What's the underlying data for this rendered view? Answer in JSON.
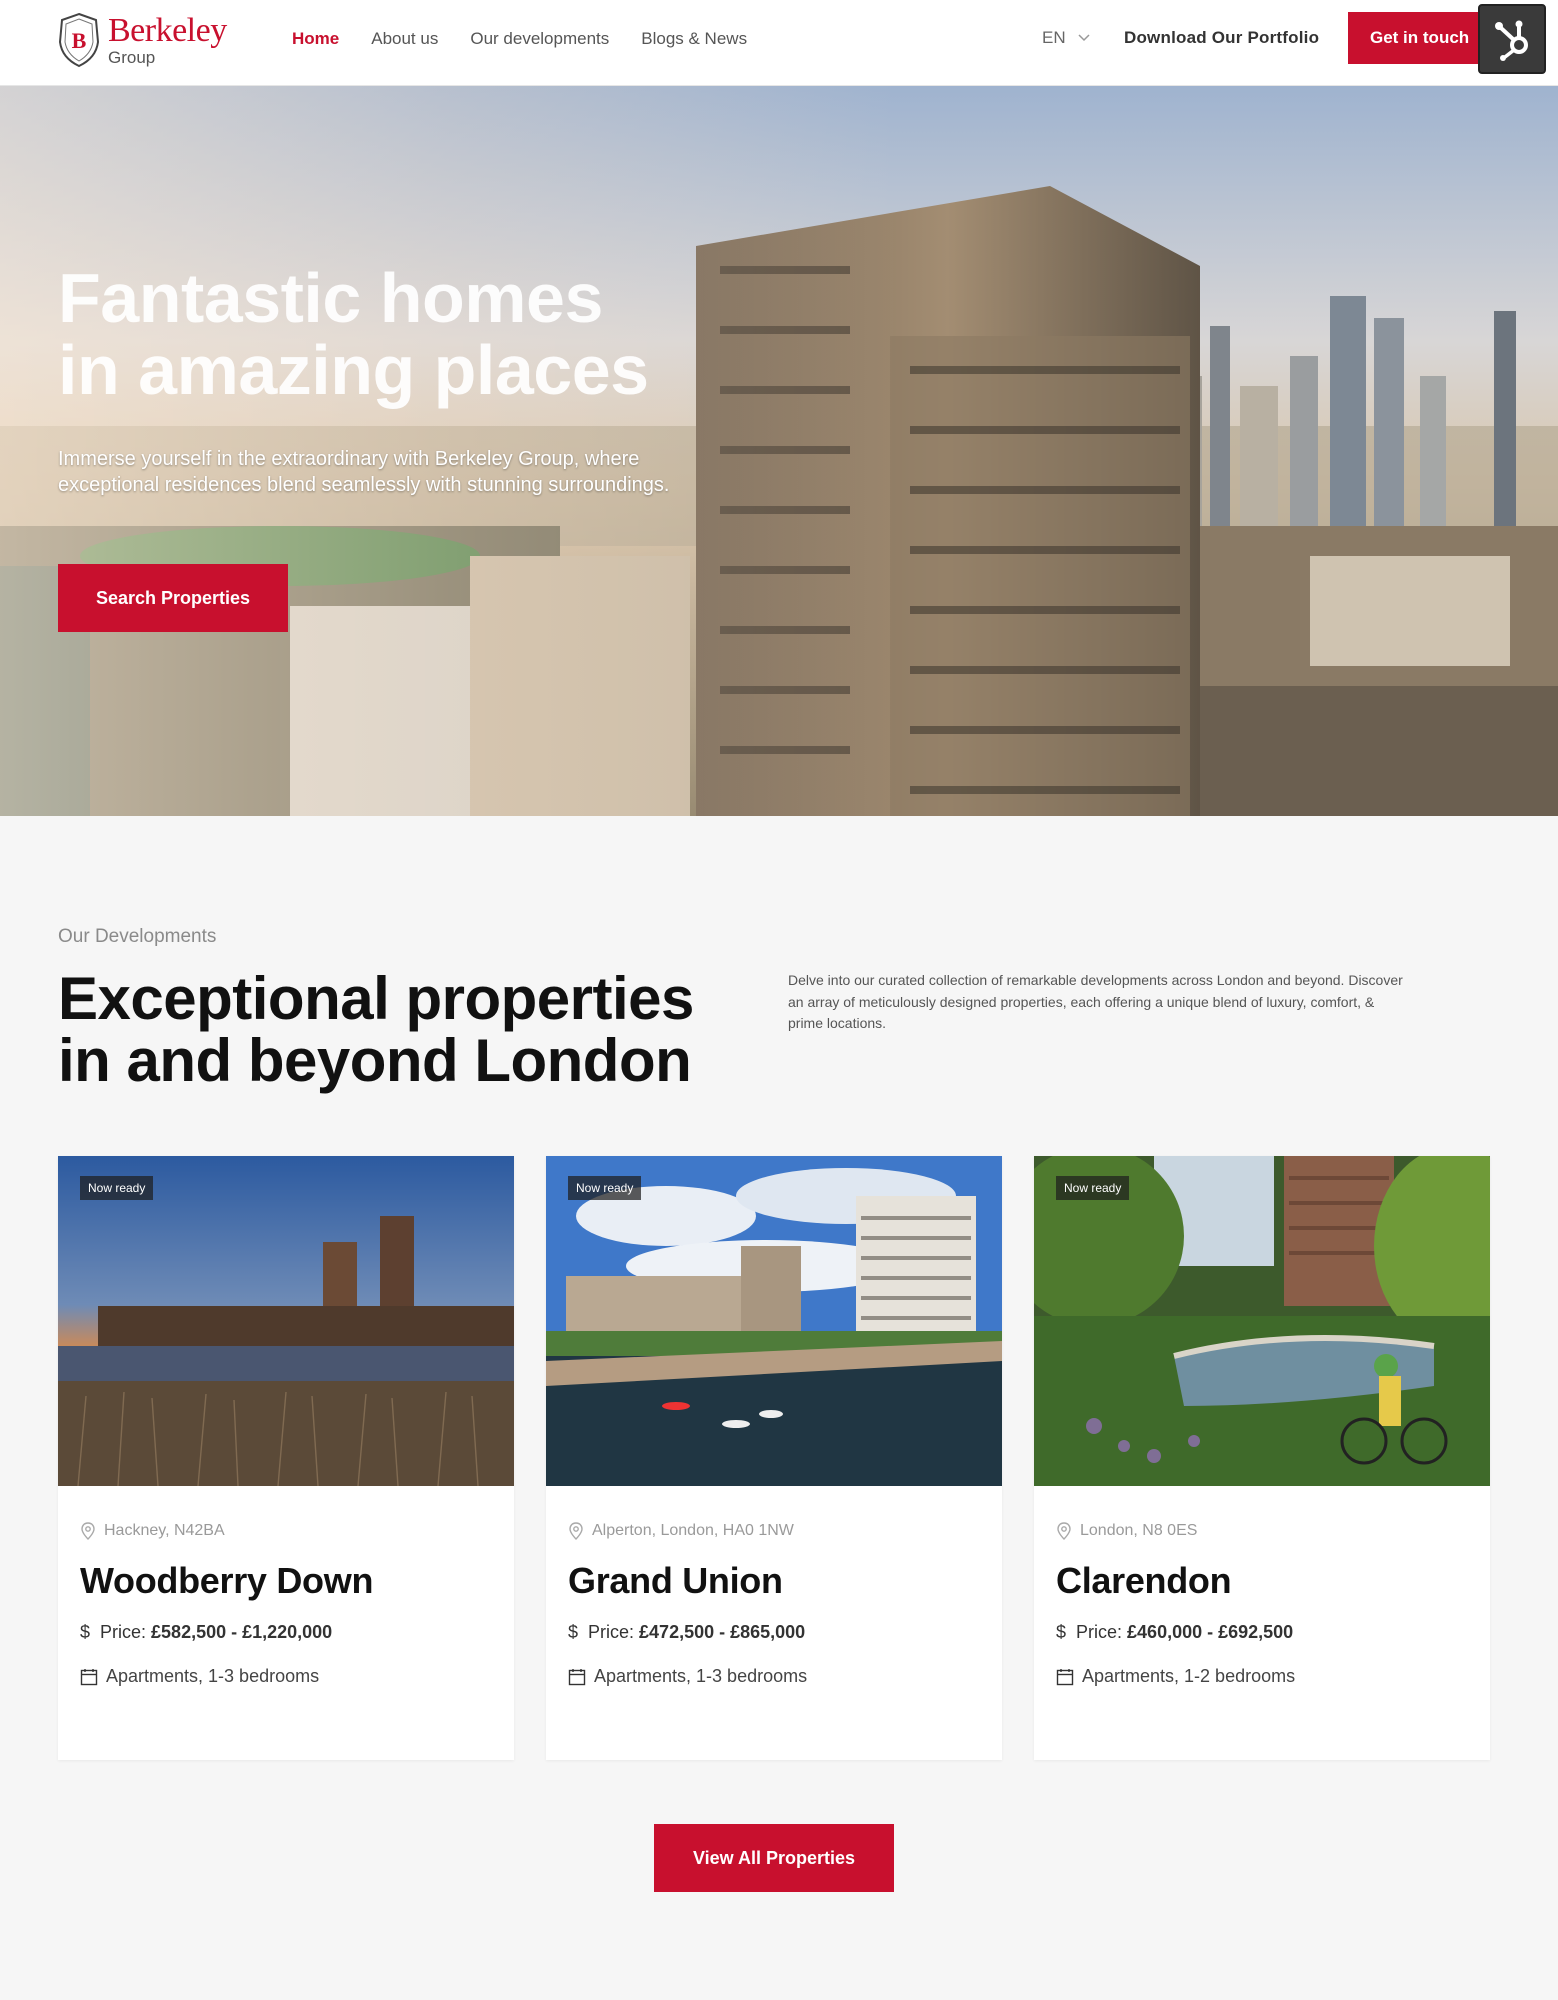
{
  "brand": {
    "name": "Berkeley",
    "sub": "Group",
    "accent": "#c8102e"
  },
  "nav": [
    {
      "label": "Home",
      "active": true
    },
    {
      "label": "About us"
    },
    {
      "label": "Our developments"
    },
    {
      "label": "Blogs & News"
    }
  ],
  "header": {
    "language": "EN",
    "portfolio_label": "Download Our Portfolio",
    "cta_label": "Get in touch"
  },
  "hero": {
    "title_line1": "Fantastic homes",
    "title_line2": "in amazing places",
    "subtitle": "Immerse yourself in the extraordinary with Berkeley Group, where exceptional residences blend seamlessly with stunning surroundings.",
    "button_label": "Search Properties"
  },
  "developments": {
    "label": "Our Developments",
    "title_line1": "Exceptional properties",
    "title_line2": "in and beyond London",
    "description": "Delve into our curated collection of remarkable developments across London and beyond. Discover an array of meticulously designed properties, each offering a unique blend of luxury, comfort, & prime locations.",
    "cards": [
      {
        "badge": "Now ready",
        "location": "Hackney, N42BA",
        "title": "Woodberry Down",
        "price_label": "Price:",
        "price": "£582,500 - £1,220,000",
        "details": "Apartments, 1-3 bedrooms"
      },
      {
        "badge": "Now ready",
        "location": "Alperton, London, HA0 1NW",
        "title": "Grand Union",
        "price_label": "Price:",
        "price": "£472,500 - £865,000",
        "details": "Apartments, 1-3 bedrooms"
      },
      {
        "badge": "Now ready",
        "location": "London, N8 0ES",
        "title": "Clarendon",
        "price_label": "Price:",
        "price": "£460,000 - £692,500",
        "details": "Apartments, 1-2 bedrooms"
      }
    ],
    "view_all_label": "View All Properties"
  }
}
